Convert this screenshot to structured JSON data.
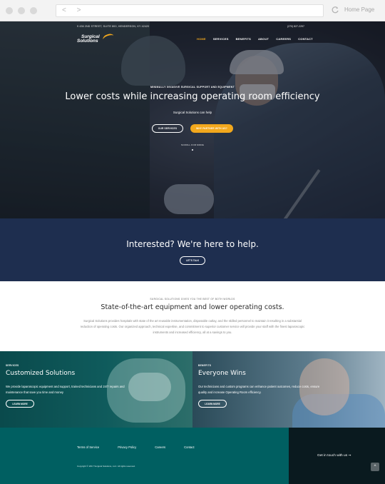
{
  "browser": {
    "nav_arrows": "< >",
    "home_label": "Home Page"
  },
  "topbar": {
    "address": "9 436 2ND STREET, SUITE 800, HENDERSON, KY 42420",
    "phone": "(270) 827-2297"
  },
  "logo": {
    "line1": "Surgical",
    "line2": "Solutions"
  },
  "nav": {
    "items": [
      "HOME",
      "SERVICES",
      "BENEFITS",
      "ABOUT",
      "CAREERS",
      "CONTACT"
    ],
    "active_index": 0
  },
  "hero": {
    "eyebrow": "MINIMALLY INVASIVE SURGICAL SUPPORT AND EQUIPMENT",
    "headline": "Lower costs while increasing operating room efficiency",
    "sub": "Surgical Solutions can help",
    "btn_services": "OUR SERVICES",
    "btn_partner": "WHY PARTNER WITH US?",
    "scroll_label": "SCROLL FOR MORE"
  },
  "interested": {
    "title": "Interested? We're here to help.",
    "button": "LET'S TALK"
  },
  "intro": {
    "eyebrow": "SURGICAL SOLUTIONS GIVES YOU THE BEST OF BOTH WORLDS",
    "heading": "State-of-the-art equipment and lower operating costs.",
    "paragraph": "Surgical Solutions provides hospitals with state of the art reusable instrumentation, disposable outlay, and the skilled personnel to maintain it resulting in a substantial reduction of operating costs. Our organized approach, technical expertise, and commitment to superior customer service will provide your staff with the finest laparoscopic instruments and increased efficiency, all at a savings to you."
  },
  "panels": {
    "left": {
      "tag": "SERVICES",
      "title": "Customized Solutions",
      "text": "We provide laparoscopic equipment and support, trained technicians and 24/7 repairs and maintenance that save you time and money",
      "button": "LEARN MORE"
    },
    "right": {
      "tag": "BENEFITS",
      "title": "Everyone Wins",
      "text": "Our technicians and custom programs can enhance patient outcomes, reduce costs, ensure quality and increase Operating Room efficiency.",
      "button": "LEARN MORE"
    }
  },
  "footer": {
    "links": [
      "Terms of Service",
      "Privacy Policy",
      "Careers",
      "Contact"
    ],
    "copyright": "Copyright © 2017 Surgical Solutions, LLC. All rights reserved.",
    "cta": "Get in touch with us ➞",
    "to_top": "^"
  },
  "colors": {
    "accent": "#f2a81d",
    "navy": "#1e2e4f",
    "teal": "#005f61",
    "cta_dark": "#0a1a1f"
  }
}
